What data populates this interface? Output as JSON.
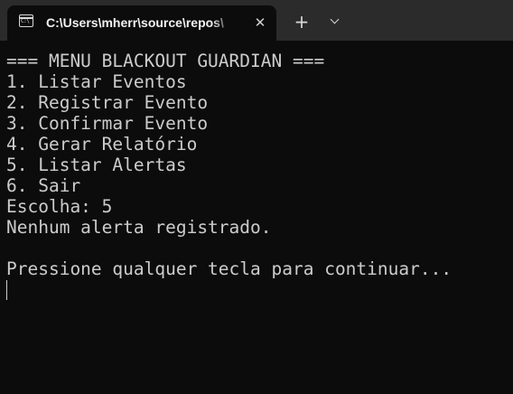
{
  "tab": {
    "icon": "console-icon",
    "icon_glyph": "C:\\",
    "title": "C:\\Users\\mherr\\source\\repos\\",
    "close_label": "✕"
  },
  "titlebar": {
    "new_tab_label": "+",
    "dropdown_icon": "chevron-down-icon"
  },
  "terminal": {
    "lines": [
      "=== MENU BLACKOUT GUARDIAN ===",
      "1. Listar Eventos",
      "2. Registrar Evento",
      "3. Confirmar Evento",
      "4. Gerar Relatório",
      "5. Listar Alertas",
      "6. Sair",
      "Escolha: 5",
      "Nenhum alerta registrado.",
      "",
      "Pressione qualquer tecla para continuar..."
    ]
  }
}
